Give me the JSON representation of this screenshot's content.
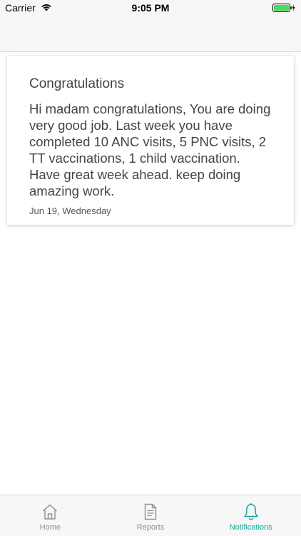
{
  "status_bar": {
    "carrier": "Carrier",
    "time": "9:05 PM",
    "battery_color": "#4cd964"
  },
  "notification": {
    "title": "Congratulations",
    "body": "Hi madam congratulations, You are doing very good job. Last week you have completed 10 ANC visits, 5 PNC visits, 2 TT vaccinations, 1 child vaccination. Have great week ahead. keep doing amazing work.",
    "date": "Jun 19, Wednesday"
  },
  "tab_bar": {
    "tabs": [
      {
        "label": "Home",
        "icon": "home-icon",
        "active": false
      },
      {
        "label": "Reports",
        "icon": "document-icon",
        "active": false
      },
      {
        "label": "Notifications",
        "icon": "bell-icon",
        "active": true
      }
    ],
    "active_color": "#1aa59a",
    "inactive_color": "#8e8e93"
  }
}
